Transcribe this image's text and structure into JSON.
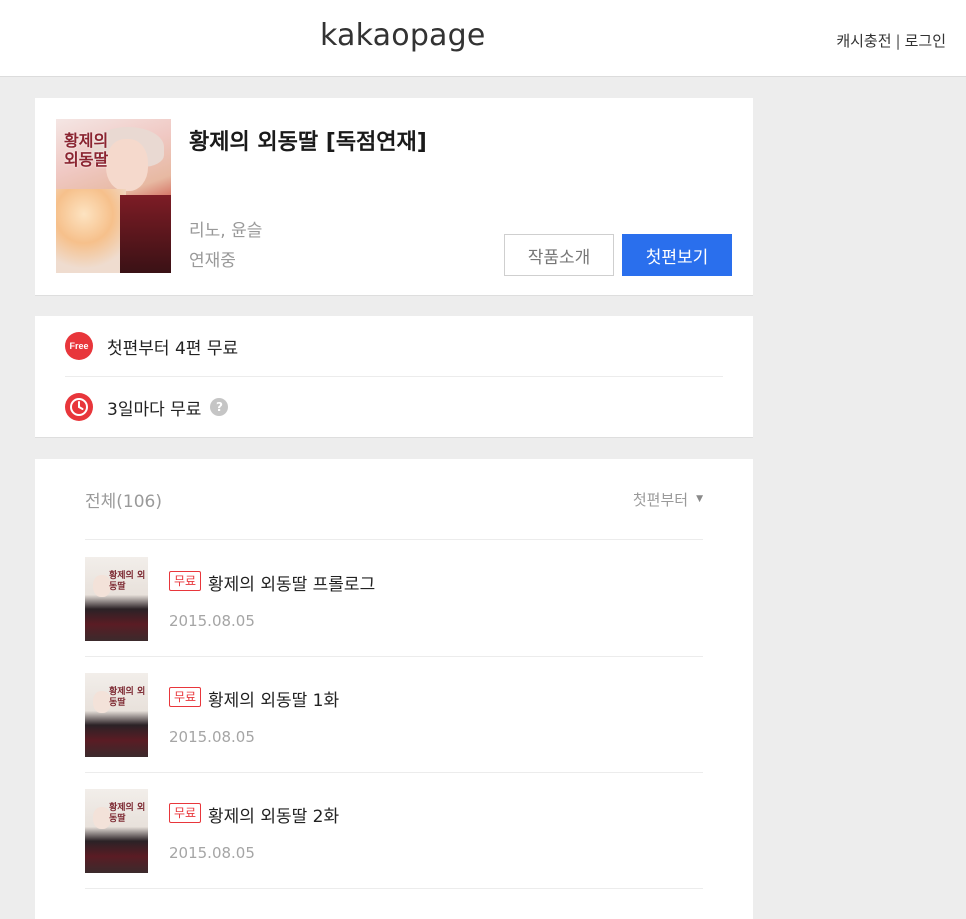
{
  "header": {
    "brand": "kakaopage",
    "charge_link": "캐시충전",
    "separator": "|",
    "login_link": "로그인"
  },
  "series": {
    "title": "황제의 외동딸 [독점연재]",
    "cover_title": "황제의 외동딸",
    "author": "리노, 윤슬",
    "status": "연재중",
    "intro_button": "작품소개",
    "first_button": "첫편보기"
  },
  "info": {
    "free_badge": "Free",
    "free_text": "첫편부터 4편 무료",
    "wait_text": "3일마다 무료",
    "help_icon": "?"
  },
  "episodes": {
    "total_label": "전체(106)",
    "sort_label": "첫편부터",
    "sort_caret": "▼",
    "thumb_text": "황제의 외동딸",
    "items": [
      {
        "badge": "무료",
        "title": "황제의 외동딸 프롤로그",
        "date": "2015.08.05"
      },
      {
        "badge": "무료",
        "title": "황제의 외동딸 1화",
        "date": "2015.08.05"
      },
      {
        "badge": "무료",
        "title": "황제의 외동딸 2화",
        "date": "2015.08.05"
      }
    ]
  },
  "colors": {
    "accent_blue": "#2a6fed",
    "accent_red": "#e8363b",
    "background": "#ededed"
  },
  "icons": {
    "free": "free-badge-icon",
    "clock": "clock-icon",
    "help": "help-icon",
    "caret": "caret-down-icon"
  }
}
